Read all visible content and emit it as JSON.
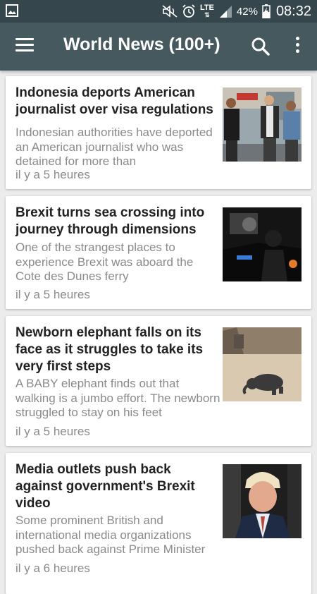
{
  "status_bar": {
    "battery": "42%",
    "time": "08:32",
    "network": "LTE"
  },
  "app_bar": {
    "title": "World News (100+)"
  },
  "articles": [
    {
      "title": "Indonesia deports American journalist over visa regulations",
      "snippet": "Indonesian authorities have deported an American journalist who was detained for more than",
      "time": "il y a 5 heures",
      "thumbnail": "photo-three-men-airport"
    },
    {
      "title": "Brexit turns sea crossing into journey through dimensions",
      "snippet": "One of the strangest places to experience Brexit was aboard the Cote des Dunes ferry",
      "time": "il y a 5 heures",
      "thumbnail": "photo-dark-ferry-night"
    },
    {
      "title": "Newborn elephant falls on its face as it struggles to take its very first steps",
      "snippet": "A BABY elephant finds out that walking is a jumbo effort. The newborn struggled to stay on his feet",
      "time": "il y a 5 heures",
      "thumbnail": "photo-baby-elephant"
    },
    {
      "title": "Media outlets push back against government's Brexit video",
      "snippet": "Some prominent British and international media organizations pushed back against Prime Minister",
      "time": "il y a 6 heures",
      "thumbnail": "photo-politician-portrait"
    }
  ],
  "colors": {
    "status_bar": "#35474d",
    "app_bar": "#45595f",
    "background": "#ececec",
    "title_text": "#222222",
    "secondary_text": "#8a8a8a"
  }
}
